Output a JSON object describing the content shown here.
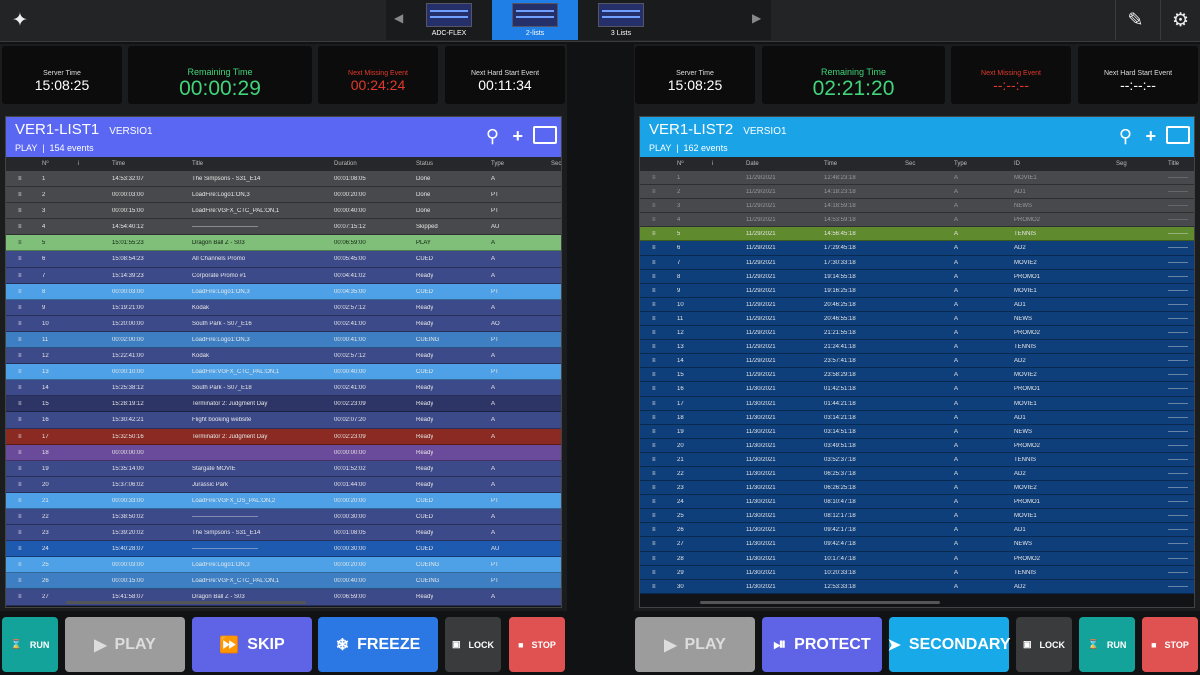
{
  "topbar": {
    "left_icon": "juggler-icon",
    "tabs": [
      {
        "label": "ADC-FLEX",
        "active": false
      },
      {
        "label": "2-lists",
        "active": true
      },
      {
        "label": "3 Lists",
        "active": false
      }
    ],
    "edit_icon": "pencil-icon",
    "settings_icon": "gear-icon"
  },
  "left": {
    "tiles": {
      "server_label": "Server Time",
      "server_value": "15:08:25",
      "remaining_label": "Remaining Time",
      "remaining_value": "00:00:29",
      "missing_label": "Next Missing Event",
      "missing_value": "00:24:24",
      "hard_label": "Next Hard Start Event",
      "hard_value": "00:11:34"
    },
    "list": {
      "name": "VER1-LIST1",
      "version": "VERSIO1",
      "mode": "PLAY",
      "events": "154 events",
      "header_color": "#5a67f2",
      "columns": [
        "Nº",
        "i",
        "Time",
        "Title",
        "Duration",
        "Status",
        "Type",
        "Sec"
      ],
      "rows": [
        {
          "n": "1",
          "t": "14:53:32:07",
          "title": "The Simpsons - S31_E14",
          "d": "00:01:08:05",
          "s": "Done",
          "ty": "A",
          "c": "#48494c"
        },
        {
          "n": "2",
          "t": "00:00:03:00",
          "title": "LoadFire:Logo1:ON,3",
          "d": "00:00:20:00",
          "s": "Done",
          "ty": "PT",
          "c": "#48494c"
        },
        {
          "n": "3",
          "t": "00:00:15:00",
          "title": "LoadFire:VGFX_CTC_PAL:ON,1",
          "d": "00:00:40:00",
          "s": "Done",
          "ty": "PT",
          "c": "#48494c"
        },
        {
          "n": "4",
          "t": "14:54:40:12",
          "title": "---------------------------------",
          "d": "00:07:15:12",
          "s": "Skipped",
          "ty": "AU",
          "c": "#48494c"
        },
        {
          "n": "5",
          "t": "15:01:55:23",
          "title": "Dragon Ball Z - S03",
          "d": "00:06:59:00",
          "s": "PLAY",
          "ty": "A",
          "c": "#7fbf7a"
        },
        {
          "n": "6",
          "t": "15:08:54:23",
          "title": "All Channels Promo",
          "d": "00:05:45:00",
          "s": "CUED",
          "ty": "A",
          "c": "#3d4a8a"
        },
        {
          "n": "7",
          "t": "15:14:39:23",
          "title": "Corporate Promo #1",
          "d": "00:04:41:02",
          "s": "Ready",
          "ty": "A",
          "c": "#3d4a8a"
        },
        {
          "n": "8",
          "t": "00:00:03:00",
          "title": "LoadFire:Logo1:ON,3",
          "d": "00:04:35:00",
          "s": "CUED",
          "ty": "PT",
          "c": "#4ea1e6"
        },
        {
          "n": "9",
          "t": "15:19:21:00",
          "title": "Kodak",
          "d": "00:02:57:12",
          "s": "Ready",
          "ty": "A",
          "c": "#3d4a8a"
        },
        {
          "n": "10",
          "t": "15:20:00:00",
          "title": "South Park - S07_E16",
          "d": "00:02:41:00",
          "s": "Ready",
          "ty": "AO",
          "c": "#3d4a8a"
        },
        {
          "n": "11",
          "t": "00:02:00:00",
          "title": "LoadFire:Logo1:ON,3",
          "d": "00:00:41:00",
          "s": "CUEING",
          "ty": "PT",
          "c": "#3e7fc4"
        },
        {
          "n": "12",
          "t": "15:22:41:00",
          "title": "Kodak",
          "d": "00:02:57:12",
          "s": "Ready",
          "ty": "A",
          "c": "#3d4a8a"
        },
        {
          "n": "13",
          "t": "00:00:10:00",
          "title": "LoadFire:VGFX_CTC_PAL:ON,1",
          "d": "00:00:40:00",
          "s": "CUED",
          "ty": "PT",
          "c": "#4ea1e6"
        },
        {
          "n": "14",
          "t": "15:25:38:12",
          "title": "South Park - S07_E18",
          "d": "00:02:41:00",
          "s": "Ready",
          "ty": "A",
          "c": "#3d4a8a"
        },
        {
          "n": "15",
          "t": "15:28:19:12",
          "title": "Terminator 2: Judgment Day",
          "d": "00:02:23:09",
          "s": "Ready",
          "ty": "A",
          "c": "#2c3566"
        },
        {
          "n": "16",
          "t": "15:30:42:21",
          "title": "Flight booking website",
          "d": "00:02:07:20",
          "s": "Ready",
          "ty": "A",
          "c": "#3d4a8a"
        },
        {
          "n": "17",
          "t": "15:32:50:16",
          "title": "Terminator 2: Judgment Day",
          "d": "00:02:23:09",
          "s": "Ready",
          "ty": "A",
          "c": "#8a2a22"
        },
        {
          "n": "18",
          "t": "00:00:00:00",
          "title": "",
          "d": "00:00:00:00",
          "s": "Ready",
          "ty": "",
          "c": "#6a4a9a"
        },
        {
          "n": "19",
          "t": "15:35:14:00",
          "title": "Stargate MOVIE",
          "d": "00:01:52:02",
          "s": "Ready",
          "ty": "A",
          "c": "#3d4a8a"
        },
        {
          "n": "20",
          "t": "15:37:06:02",
          "title": "Jurassic Park",
          "d": "00:01:44:00",
          "s": "Ready",
          "ty": "A",
          "c": "#3d4a8a"
        },
        {
          "n": "21",
          "t": "00:00:33:00",
          "title": "LoadFire:VGFX_DS_PAL:ON,2",
          "d": "00:00:20:00",
          "s": "CUED",
          "ty": "PT",
          "c": "#4ea1e6"
        },
        {
          "n": "22",
          "t": "15:38:50:02",
          "title": "---------------------------------",
          "d": "00:00:30:00",
          "s": "CUED",
          "ty": "A",
          "c": "#3d4a8a"
        },
        {
          "n": "23",
          "t": "15:39:20:02",
          "title": "The Simpsons - S31_E14",
          "d": "00:01:08:05",
          "s": "Ready",
          "ty": "A",
          "c": "#3d4a8a"
        },
        {
          "n": "24",
          "t": "15:40:28:07",
          "title": "---------------------------------",
          "d": "00:00:30:00",
          "s": "CUED",
          "ty": "AU",
          "c": "#1e5bb0"
        },
        {
          "n": "25",
          "t": "00:00:03:00",
          "title": "LoadFire:Logo1:ON,3",
          "d": "00:00:20:00",
          "s": "CUEING",
          "ty": "PT",
          "c": "#4ea1e6"
        },
        {
          "n": "26",
          "t": "00:00:15:00",
          "title": "LoadFire:VGFX_CTC_PAL:ON,1",
          "d": "00:00:40:00",
          "s": "CUEING",
          "ty": "PT",
          "c": "#3e7fc4"
        },
        {
          "n": "27",
          "t": "15:41:58:07",
          "title": "Dragon Ball Z - S03",
          "d": "00:06:59:00",
          "s": "Ready",
          "ty": "A",
          "c": "#3d4a8a"
        }
      ]
    },
    "buttons": {
      "run": "RUN",
      "play": "PLAY",
      "skip": "SKIP",
      "freeze": "FREEZE",
      "lock": "LOCK",
      "stop": "STOP"
    }
  },
  "right": {
    "tiles": {
      "server_label": "Server Time",
      "server_value": "15:08:25",
      "remaining_label": "Remaining Time",
      "remaining_value": "02:21:20",
      "missing_label": "Next Missing Event",
      "missing_value": "--:--:--",
      "hard_label": "Next Hard Start Event",
      "hard_value": "--:--:--"
    },
    "list": {
      "name": "VER1-LIST2",
      "version": "VERSIO1",
      "mode": "PLAY",
      "events": "162 events",
      "header_color": "#1aa3e6",
      "columns": [
        "Nº",
        "i",
        "Date",
        "Time",
        "Sec",
        "Type",
        "ID",
        "Seg",
        "Title"
      ],
      "rows": [
        {
          "n": "1",
          "date": "11/29/2021",
          "t": "12:48:23:18",
          "ty": "A",
          "id": "MOVIE1",
          "c": "#48494c"
        },
        {
          "n": "2",
          "date": "11/29/2021",
          "t": "14:18:23:18",
          "ty": "A",
          "id": "AD1",
          "c": "#48494c"
        },
        {
          "n": "3",
          "date": "11/29/2021",
          "t": "14:18:59:18",
          "ty": "A",
          "id": "NEWS",
          "c": "#48494c"
        },
        {
          "n": "4",
          "date": "11/29/2021",
          "t": "14:53:59:18",
          "ty": "A",
          "id": "PROMO2",
          "c": "#48494c"
        },
        {
          "n": "5",
          "date": "11/29/2021",
          "t": "14:56:45:18",
          "ty": "A",
          "id": "TENNIS",
          "c": "#5f8a2e"
        },
        {
          "n": "6",
          "date": "11/29/2021",
          "t": "17:29:45:18",
          "ty": "A",
          "id": "AD2",
          "c": "#0f3f7a"
        },
        {
          "n": "7",
          "date": "11/29/2021",
          "t": "17:30:33:18",
          "ty": "A",
          "id": "MOVIE2",
          "c": "#0f3f7a"
        },
        {
          "n": "8",
          "date": "11/29/2021",
          "t": "19:14:55:18",
          "ty": "A",
          "id": "PROMO1",
          "c": "#0f3f7a"
        },
        {
          "n": "9",
          "date": "11/29/2021",
          "t": "19:16:25:18",
          "ty": "A",
          "id": "MOVIE1",
          "c": "#0f3f7a"
        },
        {
          "n": "10",
          "date": "11/29/2021",
          "t": "20:46:25:18",
          "ty": "A",
          "id": "AD1",
          "c": "#0f3f7a"
        },
        {
          "n": "11",
          "date": "11/29/2021",
          "t": "20:46:55:18",
          "ty": "A",
          "id": "NEWS",
          "c": "#0f3f7a"
        },
        {
          "n": "12",
          "date": "11/29/2021",
          "t": "21:21:55:18",
          "ty": "A",
          "id": "PROMO2",
          "c": "#0f3f7a"
        },
        {
          "n": "13",
          "date": "11/29/2021",
          "t": "21:24:41:18",
          "ty": "A",
          "id": "TENNIS",
          "c": "#0f3f7a"
        },
        {
          "n": "14",
          "date": "11/29/2021",
          "t": "23:57:41:18",
          "ty": "A",
          "id": "AD2",
          "c": "#0f3f7a"
        },
        {
          "n": "15",
          "date": "11/29/2021",
          "t": "23:58:29:18",
          "ty": "A",
          "id": "MOVIE2",
          "c": "#0f3f7a"
        },
        {
          "n": "16",
          "date": "11/30/2021",
          "t": "01:42:51:18",
          "ty": "A",
          "id": "PROMO1",
          "c": "#0f3f7a"
        },
        {
          "n": "17",
          "date": "11/30/2021",
          "t": "01:44:21:18",
          "ty": "A",
          "id": "MOVIE1",
          "c": "#0f3f7a"
        },
        {
          "n": "18",
          "date": "11/30/2021",
          "t": "03:14:21:18",
          "ty": "A",
          "id": "AD1",
          "c": "#0f3f7a"
        },
        {
          "n": "19",
          "date": "11/30/2021",
          "t": "03:14:51:18",
          "ty": "A",
          "id": "NEWS",
          "c": "#0f3f7a"
        },
        {
          "n": "20",
          "date": "11/30/2021",
          "t": "03:49:51:18",
          "ty": "A",
          "id": "PROMO2",
          "c": "#0f3f7a"
        },
        {
          "n": "21",
          "date": "11/30/2021",
          "t": "03:52:37:18",
          "ty": "A",
          "id": "TENNIS",
          "c": "#0f3f7a"
        },
        {
          "n": "22",
          "date": "11/30/2021",
          "t": "06:25:37:18",
          "ty": "A",
          "id": "AD2",
          "c": "#0f3f7a"
        },
        {
          "n": "23",
          "date": "11/30/2021",
          "t": "06:26:25:18",
          "ty": "A",
          "id": "MOVIE2",
          "c": "#0f3f7a"
        },
        {
          "n": "24",
          "date": "11/30/2021",
          "t": "08:10:47:18",
          "ty": "A",
          "id": "PROMO1",
          "c": "#0f3f7a"
        },
        {
          "n": "25",
          "date": "11/30/2021",
          "t": "08:12:17:18",
          "ty": "A",
          "id": "MOVIE1",
          "c": "#0f3f7a"
        },
        {
          "n": "26",
          "date": "11/30/2021",
          "t": "09:42:17:18",
          "ty": "A",
          "id": "AD1",
          "c": "#0f3f7a"
        },
        {
          "n": "27",
          "date": "11/30/2021",
          "t": "09:42:47:18",
          "ty": "A",
          "id": "NEWS",
          "c": "#0f3f7a"
        },
        {
          "n": "28",
          "date": "11/30/2021",
          "t": "10:17:47:18",
          "ty": "A",
          "id": "PROMO2",
          "c": "#0f3f7a"
        },
        {
          "n": "29",
          "date": "11/30/2021",
          "t": "10:20:33:18",
          "ty": "A",
          "id": "TENNIS",
          "c": "#0f3f7a"
        },
        {
          "n": "30",
          "date": "11/30/2021",
          "t": "12:53:33:18",
          "ty": "A",
          "id": "AD2",
          "c": "#0f3f7a"
        }
      ],
      "title_placeholder": "----------"
    },
    "buttons": {
      "play": "PLAY",
      "protect": "PROTECT",
      "secondary": "SECONDARY",
      "lock": "LOCK",
      "run": "RUN",
      "stop": "STOP"
    }
  },
  "colors": {
    "run": "#14a39a",
    "play": "#9c9c9c",
    "skip": "#5f63e6",
    "freeze": "#2b78e4",
    "lock": "#3a3b3d",
    "stop": "#e05252",
    "protect": "#5f63e6",
    "secondary": "#17a9e8"
  }
}
